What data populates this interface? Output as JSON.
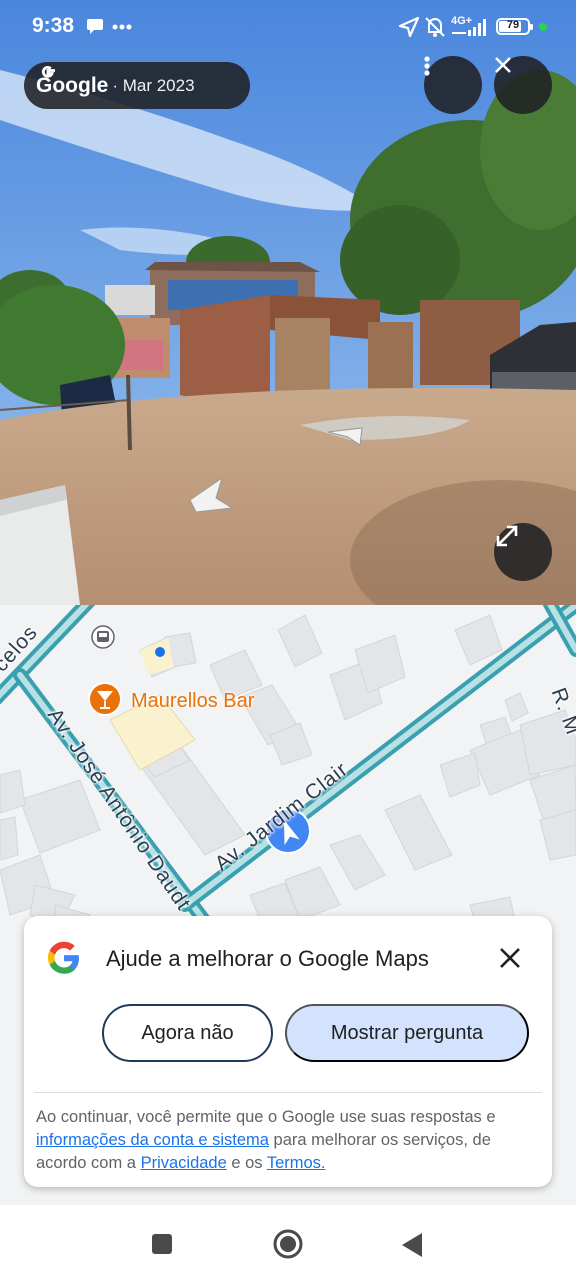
{
  "status_bar": {
    "time": "9:38",
    "network": "4G+",
    "battery_level": "79",
    "battery_fraction": 0.79,
    "icons": [
      "message-icon",
      "more-dots-icon",
      "location-arrow-icon",
      "bell-muted-icon",
      "signal-icon",
      "battery-icon"
    ]
  },
  "street_view": {
    "brand": "Google",
    "date": "· Mar 2023",
    "menu_icon": "vertical-dots-icon",
    "close_icon": "close-icon",
    "expand_icon": "expand-icon"
  },
  "map": {
    "poi_name": "Maurellos Bar",
    "street_1": "Av. José Antônio Daudt",
    "street_2": "Av. Jardim Clair",
    "street_3": "celos",
    "street_4": "R. M",
    "colors": {
      "road": "#4db6c5",
      "road_border": "#3aa0b0",
      "poi": "#e8710a",
      "you_are_here": "#4285f4"
    }
  },
  "survey_card": {
    "title": "Ajude a melhorar o Google Maps",
    "dismiss_label": "Agora não",
    "show_label": "Mostrar pergunta",
    "disclaimer_1": "Ao continuar, você permite que o Google use suas respostas e ",
    "link_account": "informações da conta e sistema",
    "disclaimer_2": " para melhorar os serviços, de acordo com a ",
    "link_privacy": "Privacidade",
    "disclaimer_3": " e os ",
    "link_terms": "Termos.",
    "disclaimer_4": ""
  },
  "navbar": {
    "icons": [
      "recents-square-icon",
      "home-circle-icon",
      "back-triangle-icon"
    ]
  }
}
